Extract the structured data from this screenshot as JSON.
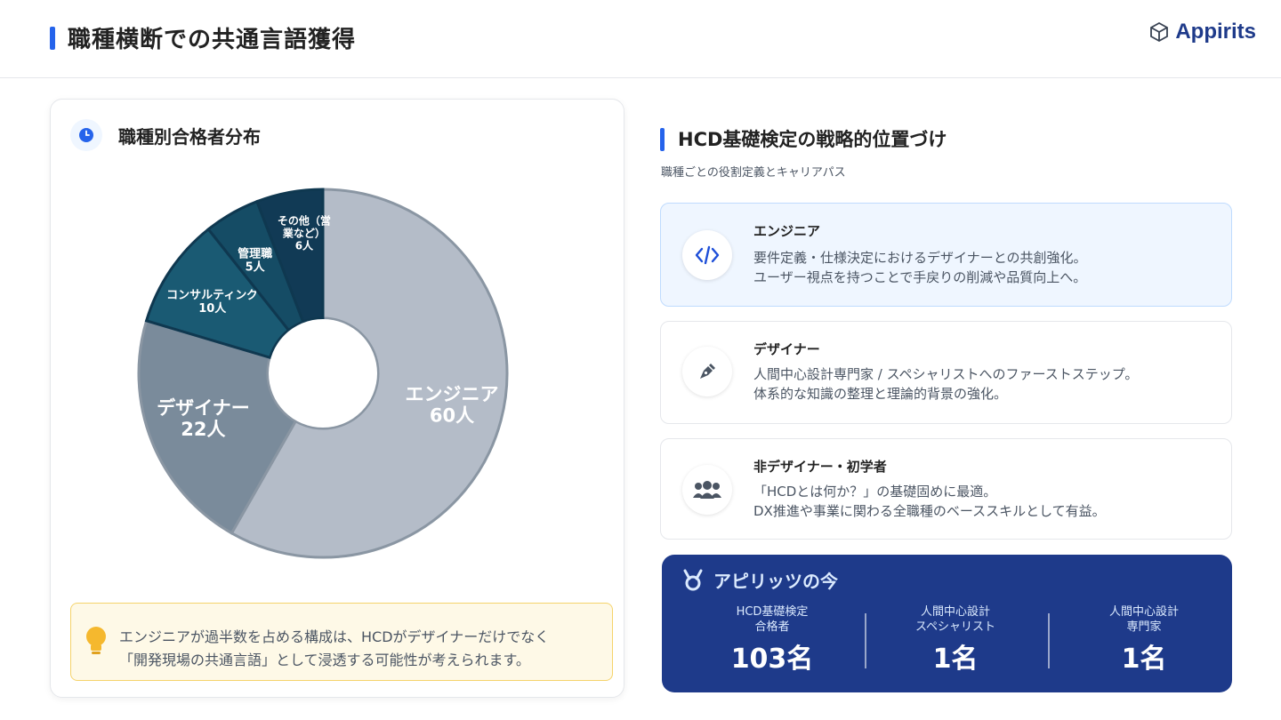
{
  "header": {
    "title": "職種横断での共通言語獲得",
    "brand": "Appirits"
  },
  "left_card": {
    "title": "職種別合格者分布",
    "note": {
      "line1": "エンジニアが過半数を占める構成は、HCDがデザイナーだけでなく",
      "line2": "「開発現場の共通言語」として浸透する可能性が考えられます。"
    }
  },
  "chart_data": {
    "type": "pie",
    "donut": true,
    "categories": [
      "エンジニア",
      "デザイナー",
      "コンサルティング",
      "管理職",
      "その他（営業など）"
    ],
    "values": [
      60,
      22,
      10,
      5,
      6
    ],
    "value_labels": [
      "60人",
      "22人",
      "10人",
      "5人",
      "6人"
    ],
    "colors": [
      "#b4bcc8",
      "#7a8b9b",
      "#1a5a73",
      "#154c65",
      "#113a55"
    ]
  },
  "right": {
    "section_title": "HCD基礎検定の戦略的位置づけ",
    "section_subtitle": "職種ごとの役割定義とキャリアパス",
    "roles": [
      {
        "name": "エンジニア",
        "line1": "要件定義・仕様決定におけるデザイナーとの共創強化。",
        "line2": "ユーザー視点を持つことで手戻りの削減や品質向上へ。",
        "icon": "code-icon"
      },
      {
        "name": "デザイナー",
        "line1": "人間中心設計専門家 / スペシャリストへのファーストステップ。",
        "line2": "体系的な知識の整理と理論的背景の強化。",
        "icon": "pen-icon"
      },
      {
        "name": "非デザイナー・初学者",
        "line1": "「HCDとは何か？」の基礎固めに最適。",
        "line2": "DX推進や事業に関わる全職種のベーススキルとして有益。",
        "icon": "users-icon"
      }
    ],
    "stats": {
      "title": "アピリッツの今",
      "items": [
        {
          "label_line1": "HCD基礎検定",
          "label_line2": "合格者",
          "value": "103名"
        },
        {
          "label_line1": "人間中心設計",
          "label_line2": "スペシャリスト",
          "value": "1名"
        },
        {
          "label_line1": "人間中心設計",
          "label_line2": "専門家",
          "value": "1名"
        }
      ]
    }
  },
  "colors": {
    "accent": "#2563eb",
    "navy": "#1e3a8a",
    "note_bg": "#fef9e7",
    "note_border": "#f5d36b"
  }
}
